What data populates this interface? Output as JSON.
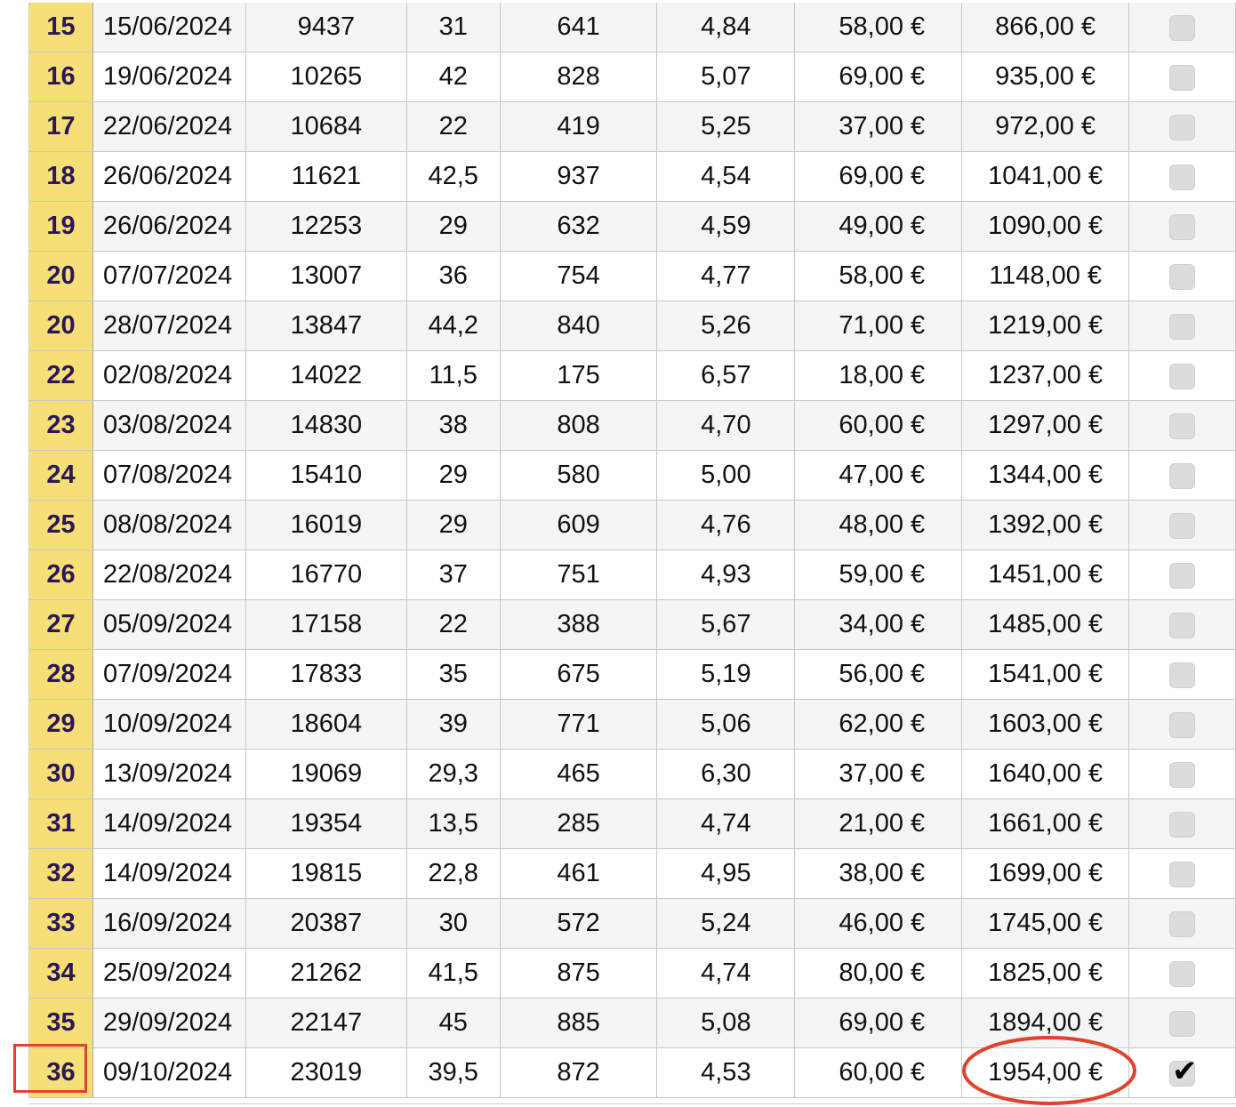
{
  "annotation_color": "#e0432d",
  "row_number_bg": "#f7df78",
  "rows": [
    {
      "n": "15",
      "date": "15/06/2024",
      "odo": "9437",
      "liters": "31",
      "km": "641",
      "rate": "4,84",
      "cost": "58,00 €",
      "total": "866,00 €",
      "checked": false
    },
    {
      "n": "16",
      "date": "19/06/2024",
      "odo": "10265",
      "liters": "42",
      "km": "828",
      "rate": "5,07",
      "cost": "69,00 €",
      "total": "935,00 €",
      "checked": false
    },
    {
      "n": "17",
      "date": "22/06/2024",
      "odo": "10684",
      "liters": "22",
      "km": "419",
      "rate": "5,25",
      "cost": "37,00 €",
      "total": "972,00 €",
      "checked": false
    },
    {
      "n": "18",
      "date": "26/06/2024",
      "odo": "11621",
      "liters": "42,5",
      "km": "937",
      "rate": "4,54",
      "cost": "69,00 €",
      "total": "1041,00 €",
      "checked": false
    },
    {
      "n": "19",
      "date": "26/06/2024",
      "odo": "12253",
      "liters": "29",
      "km": "632",
      "rate": "4,59",
      "cost": "49,00 €",
      "total": "1090,00 €",
      "checked": false
    },
    {
      "n": "20",
      "date": "07/07/2024",
      "odo": "13007",
      "liters": "36",
      "km": "754",
      "rate": "4,77",
      "cost": "58,00 €",
      "total": "1148,00 €",
      "checked": false
    },
    {
      "n": "20",
      "date": "28/07/2024",
      "odo": "13847",
      "liters": "44,2",
      "km": "840",
      "rate": "5,26",
      "cost": "71,00 €",
      "total": "1219,00 €",
      "checked": false
    },
    {
      "n": "22",
      "date": "02/08/2024",
      "odo": "14022",
      "liters": "11,5",
      "km": "175",
      "rate": "6,57",
      "cost": "18,00 €",
      "total": "1237,00 €",
      "checked": false
    },
    {
      "n": "23",
      "date": "03/08/2024",
      "odo": "14830",
      "liters": "38",
      "km": "808",
      "rate": "4,70",
      "cost": "60,00 €",
      "total": "1297,00 €",
      "checked": false
    },
    {
      "n": "24",
      "date": "07/08/2024",
      "odo": "15410",
      "liters": "29",
      "km": "580",
      "rate": "5,00",
      "cost": "47,00 €",
      "total": "1344,00 €",
      "checked": false
    },
    {
      "n": "25",
      "date": "08/08/2024",
      "odo": "16019",
      "liters": "29",
      "km": "609",
      "rate": "4,76",
      "cost": "48,00 €",
      "total": "1392,00 €",
      "checked": false
    },
    {
      "n": "26",
      "date": "22/08/2024",
      "odo": "16770",
      "liters": "37",
      "km": "751",
      "rate": "4,93",
      "cost": "59,00 €",
      "total": "1451,00 €",
      "checked": false
    },
    {
      "n": "27",
      "date": "05/09/2024",
      "odo": "17158",
      "liters": "22",
      "km": "388",
      "rate": "5,67",
      "cost": "34,00 €",
      "total": "1485,00 €",
      "checked": false
    },
    {
      "n": "28",
      "date": "07/09/2024",
      "odo": "17833",
      "liters": "35",
      "km": "675",
      "rate": "5,19",
      "cost": "56,00 €",
      "total": "1541,00 €",
      "checked": false
    },
    {
      "n": "29",
      "date": "10/09/2024",
      "odo": "18604",
      "liters": "39",
      "km": "771",
      "rate": "5,06",
      "cost": "62,00 €",
      "total": "1603,00 €",
      "checked": false
    },
    {
      "n": "30",
      "date": "13/09/2024",
      "odo": "19069",
      "liters": "29,3",
      "km": "465",
      "rate": "6,30",
      "cost": "37,00 €",
      "total": "1640,00 €",
      "checked": false
    },
    {
      "n": "31",
      "date": "14/09/2024",
      "odo": "19354",
      "liters": "13,5",
      "km": "285",
      "rate": "4,74",
      "cost": "21,00 €",
      "total": "1661,00 €",
      "checked": false
    },
    {
      "n": "32",
      "date": "14/09/2024",
      "odo": "19815",
      "liters": "22,8",
      "km": "461",
      "rate": "4,95",
      "cost": "38,00 €",
      "total": "1699,00 €",
      "checked": false
    },
    {
      "n": "33",
      "date": "16/09/2024",
      "odo": "20387",
      "liters": "30",
      "km": "572",
      "rate": "5,24",
      "cost": "46,00 €",
      "total": "1745,00 €",
      "checked": false
    },
    {
      "n": "34",
      "date": "25/09/2024",
      "odo": "21262",
      "liters": "41,5",
      "km": "875",
      "rate": "4,74",
      "cost": "80,00 €",
      "total": "1825,00 €",
      "checked": false
    },
    {
      "n": "35",
      "date": "29/09/2024",
      "odo": "22147",
      "liters": "45",
      "km": "885",
      "rate": "5,08",
      "cost": "69,00 €",
      "total": "1894,00 €",
      "checked": false
    },
    {
      "n": "36",
      "date": "09/10/2024",
      "odo": "23019",
      "liters": "39,5",
      "km": "872",
      "rate": "4,53",
      "cost": "60,00 €",
      "total": "1954,00 €",
      "checked": true
    }
  ]
}
